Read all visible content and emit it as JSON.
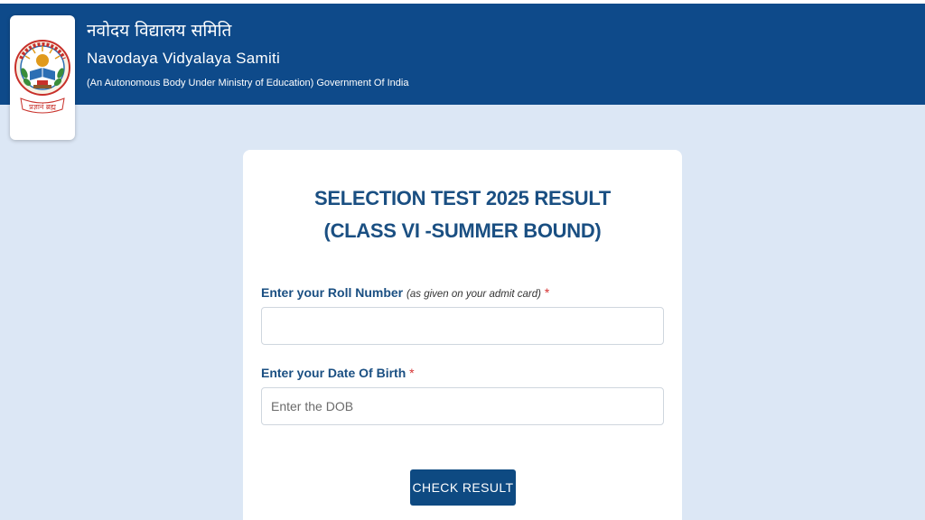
{
  "header": {
    "title_hindi": "नवोदय विद्यालय समिति",
    "title_english": "Navodaya Vidyalaya Samiti",
    "subtitle": "(An Autonomous Body Under Ministry of Education) Government Of India",
    "logo_icon": "nvs-emblem-icon",
    "logo_motto": "प्रज्ञानं ब्रह्म",
    "background_color": "#0e4a8a"
  },
  "form": {
    "title_line1": "SELECTION TEST 2025 RESULT",
    "title_line2": "(CLASS VI -SUMMER BOUND)",
    "roll": {
      "label": "Enter your Roll Number",
      "hint": "(as given on your admit card)",
      "required_mark": "*",
      "value": "",
      "placeholder": ""
    },
    "dob": {
      "label": "Enter your Date Of Birth",
      "required_mark": "*",
      "value": "",
      "placeholder": "Enter the DOB"
    },
    "submit_label": "CHECK RESULT"
  },
  "colors": {
    "page_background": "#dce7f5",
    "title_color": "#1a4f82",
    "button_color": "#0e4a82",
    "required_color": "#d63333"
  }
}
